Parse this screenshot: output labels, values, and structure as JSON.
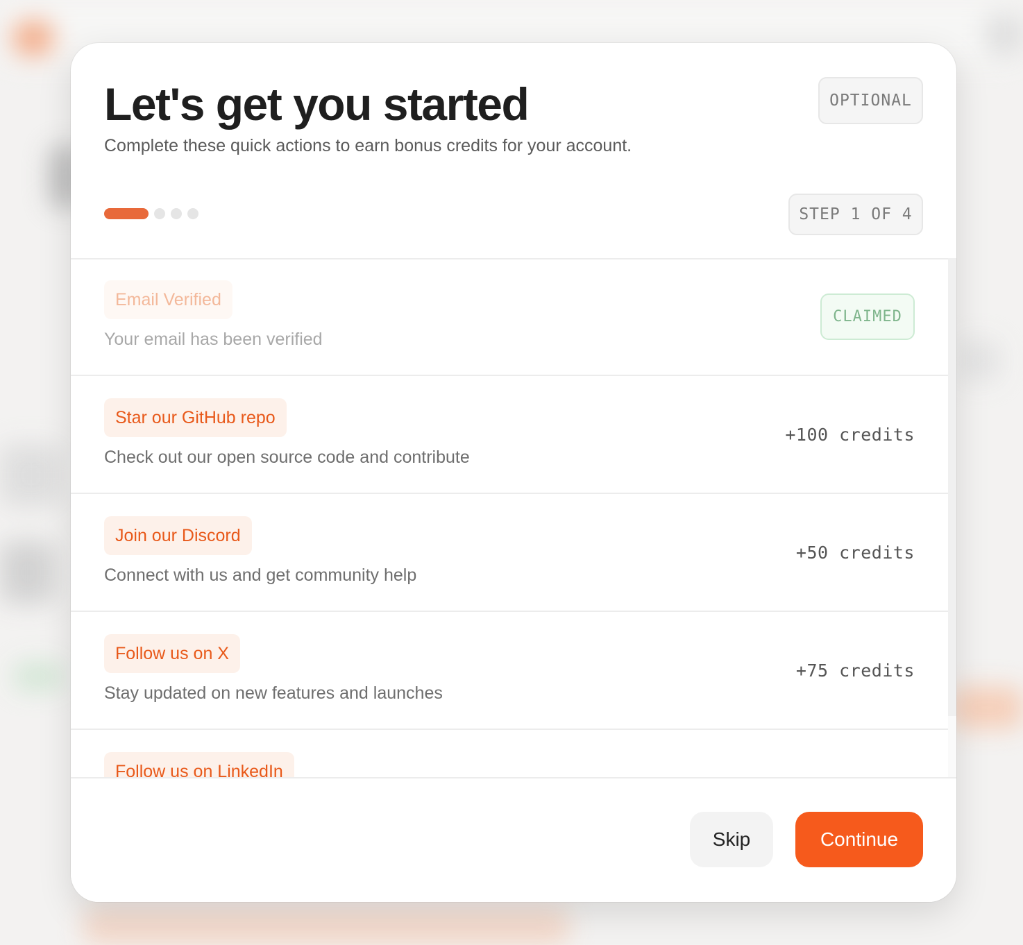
{
  "modal": {
    "title": "Let's get you started",
    "subtitle": "Complete these quick actions to earn bonus credits for your account.",
    "optional_badge": "OPTIONAL",
    "step_label": "STEP 1 OF 4",
    "progress": {
      "current_step": 1,
      "total_steps": 4
    }
  },
  "tasks": [
    {
      "label": "Email Verified",
      "description": "Your email has been verified",
      "status": "CLAIMED",
      "claimed": true
    },
    {
      "label": "Star our GitHub repo",
      "description": "Check out our open source code and contribute",
      "credits": "+100 credits",
      "claimed": false
    },
    {
      "label": "Join our Discord",
      "description": "Connect with us and get community help",
      "credits": "+50 credits",
      "claimed": false
    },
    {
      "label": "Follow us on X",
      "description": "Stay updated on new features and launches",
      "credits": "+75 credits",
      "claimed": false
    },
    {
      "label": "Follow us on LinkedIn",
      "claimed": false
    }
  ],
  "footer": {
    "skip_label": "Skip",
    "continue_label": "Continue"
  },
  "colors": {
    "accent": "#f65a1c",
    "label_bg": "#fdf1ea",
    "claimed_green": "#7fb58c",
    "progress_active": "#e8693a",
    "progress_inactive": "#e5e5e5"
  }
}
